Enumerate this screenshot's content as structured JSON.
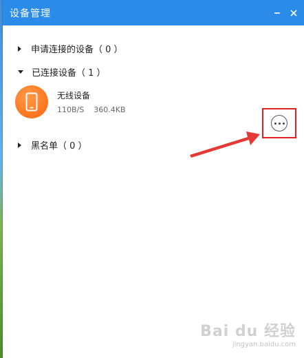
{
  "window": {
    "title": "设备管理",
    "minimize_glyph": "−",
    "close_glyph": "✕"
  },
  "groups": {
    "pending": {
      "label": "申请连接的设备",
      "count": "（ 0 ）"
    },
    "connected": {
      "label": "已连接设备",
      "count": "（ 1 ）"
    },
    "blacklist": {
      "label": "黑名单",
      "count": "（ 0 ）"
    }
  },
  "device": {
    "name": "无线设备",
    "speed": "110B/S",
    "size": "360.4KB",
    "icon": "phone-icon",
    "avatar_color": "#ff7a22"
  },
  "more_button": {
    "icon": "more-dots-icon",
    "highlight_color": "#e02020"
  },
  "annotation": {
    "arrow_color": "#e53935"
  },
  "watermark": {
    "text": "Bai du 经验",
    "sub": "jingyan.baidu.com"
  },
  "colors": {
    "titlebar": "#2b8be8"
  }
}
